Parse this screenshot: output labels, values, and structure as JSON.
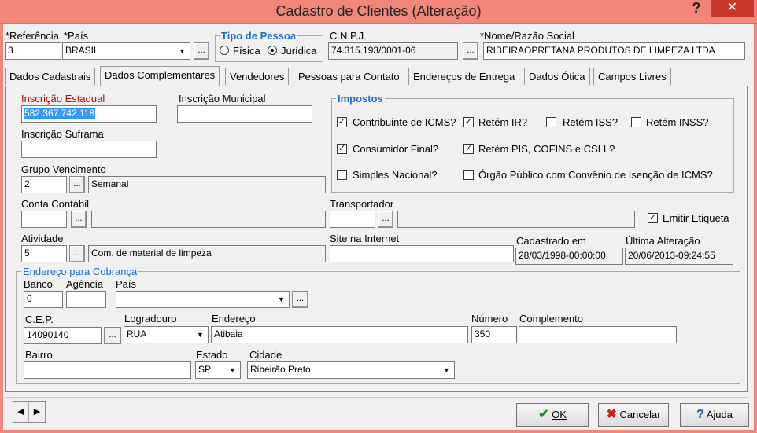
{
  "window": {
    "title": "Cadastro de Clientes (Alteração)",
    "help": "?",
    "close": "✕"
  },
  "header": {
    "referencia_label": "*Referência",
    "referencia_value": "3",
    "pais_label": "*País",
    "pais_value": "BRASIL",
    "tipo_pessoa_label": "Tipo de Pessoa",
    "fisica_label": "Física",
    "juridica_label": "Jurídica",
    "tipo_selected": "juridica",
    "cnpj_label": "C.N.P.J.",
    "cnpj_value": "74.315.193/0001-06",
    "nome_label": "*Nome/Razão Social",
    "nome_value": "RIBEIRAOPRETANA PRODUTOS DE LIMPEZA LTDA"
  },
  "tabs": [
    {
      "label": "Dados Cadastrais"
    },
    {
      "label": "Dados Complementares"
    },
    {
      "label": "Vendedores"
    },
    {
      "label": "Pessoas para Contato"
    },
    {
      "label": "Endereços de Entrega"
    },
    {
      "label": "Dados Ótica"
    },
    {
      "label": "Campos Livres"
    }
  ],
  "active_tab": "Dados Complementares",
  "form": {
    "inscricao_estadual_label": "Inscrição Estadual",
    "inscricao_estadual_value": "582.367.742.118",
    "inscricao_municipal_label": "Inscrição Municipal",
    "inscricao_municipal_value": "",
    "inscricao_suframa_label": "Inscrição Suframa",
    "inscricao_suframa_value": "",
    "grupo_vencimento_label": "Grupo Vencimento",
    "grupo_vencimento_code": "2",
    "grupo_vencimento_desc": "Semanal",
    "conta_contabil_label": "Conta Contábil",
    "conta_contabil_code": "",
    "conta_contabil_desc": "",
    "transportador_label": "Transportador",
    "transportador_code": "",
    "transportador_desc": "",
    "emitir_etiqueta_label": "Emitir Etiqueta",
    "emitir_etiqueta_checked": true,
    "atividade_label": "Atividade",
    "atividade_code": "5",
    "atividade_desc": "Com. de material de limpeza",
    "site_label": "Site na Internet",
    "site_value": "",
    "cadastrado_label": "Cadastrado em",
    "cadastrado_value": "28/03/1998-00:00:00",
    "ultima_alteracao_label": "Última Alteração",
    "ultima_alteracao_value": "20/06/2013-09:24:55"
  },
  "impostos": {
    "title": "Impostos",
    "items": [
      {
        "label": "Contribuinte de ICMS?",
        "checked": true
      },
      {
        "label": "Retém IR?",
        "checked": true
      },
      {
        "label": "Retém ISS?",
        "checked": false
      },
      {
        "label": "Retém INSS?",
        "checked": false
      },
      {
        "label": "Consumidor Final?",
        "checked": true
      },
      {
        "label": "Retém PIS, COFINS e CSLL?",
        "checked": true
      },
      {
        "label": "Simples Nacional?",
        "checked": false
      },
      {
        "label": "Órgão Público com Convênio de Isenção de ICMS?",
        "checked": false
      }
    ]
  },
  "cobranca": {
    "title": "Endereço para Cobrança",
    "banco_label": "Banco",
    "banco_value": "0",
    "agencia_label": "Agência",
    "agencia_value": "",
    "pais_label": "País",
    "pais_value": "",
    "cep_label": "C.E.P.",
    "cep_value": "14090140",
    "logradouro_label": "Logradouro",
    "logradouro_value": "RUA",
    "endereco_label": "Endereço",
    "endereco_value": "Atibaia",
    "numero_label": "Número",
    "numero_value": "350",
    "complemento_label": "Complemento",
    "complemento_value": "",
    "bairro_label": "Bairro",
    "bairro_value": "",
    "estado_label": "Estado",
    "estado_value": "SP",
    "cidade_label": "Cidade",
    "cidade_value": "Ribeirão Preto"
  },
  "footer": {
    "ok_label": "OK",
    "cancelar_label": "Cancelar",
    "ajuda_label": "Ajuda"
  },
  "colors": {
    "titlebar": "#f2867a",
    "close": "#c7382b",
    "accent": "#1a6fd0",
    "required": "#cc0000"
  }
}
